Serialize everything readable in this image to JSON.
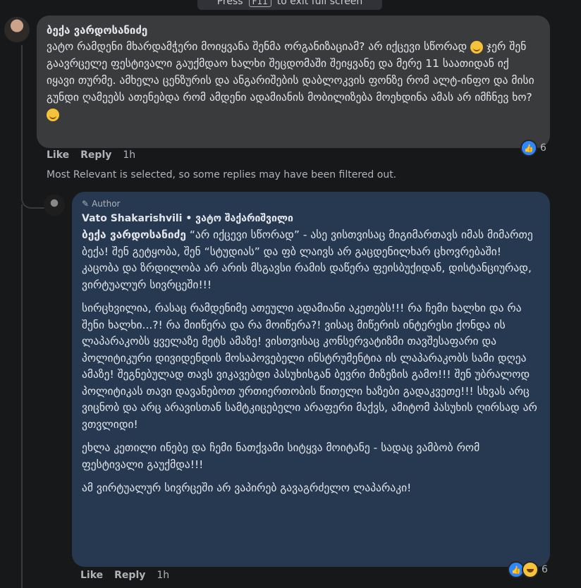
{
  "fullscreen_hint": {
    "prefix": "Press",
    "key": "F11",
    "suffix": "to exit full screen"
  },
  "comment": {
    "author": "ბექა ვარდოსანიძე",
    "text_part1": "ვატო რამდენი მხარდამჭერი მოიყვანა შენმა ორგანიზაციამ? არ იქცევი სწორად",
    "text_part2": "ჯერ შენ გაავრცელე ფესტივალი გაუქმდაო ხალხი შეცდომაში შეიყვანე და მერე 11 საათიდან იქ იყავი თურმე. ამხელა ცენზურის და ანგარიშების დაბლოკვის ფონზე რომ ალტ-ინფო და მისი გუნდი ღამეებს ათენებდა რომ ამდენი ადამიანის მობილიზება მოეხდინა ამას არ იმჩნევ ხო?",
    "like_label": "Like",
    "reply_label": "Reply",
    "time": "1h",
    "reaction_count": "6",
    "reaction_icon": "like-icon"
  },
  "filter_note": "Most Relevant is selected, so some replies may have been filtered out.",
  "reply": {
    "badge": "Author",
    "author_line": "Vato Shakarishvili • ვატო შაქარიშვილი",
    "mention": "ბექა ვარდოსანიძე",
    "p1_rest": " “არ იქცევი სწორად” - ასე ვისთვისაც მიგიმართავს იმას მიმართე ბექა! შენ გეტყობა, შენ “სტუდიას” და ფბ ლაივს არ გაცდენილხარ ცხოვრებაში! კაცობა და ზრდილობა არ არის მსგავსი რამის დაწერა ფეისბუქიდან, დისტანციურად, ვირტუალურ სივრცეში!!!",
    "p2": "სირცხვილია, რასაც რამდენიმე ათეული ადამიანი აკეთებს!!! რა ჩემი ხალხი და რა შენი ხალხი...?! რა მიიწერა და რა მოიწერა?! ვისაც მიწერის ინტერესი ქონდა ის ლაპარაკობს ყველაზე მეტს ამაზე! ვისთვისაც კონსერვატიზმი თავშესაფარი და პოლიტიკური დივიდენდის მოსაპოვებელი ინსტრუმენტია ის ლაპარაკობს სამი დღეა ამაზე! შეგნებულად თავს ვიკავებდი პასუხისგან ბევრი მიზეზის გამო!!! შენ უბრალოდ პოლიტიკას თავი დავანებოთ ურთიერთობის წითელი ხაზები გადაკვეთე!!! სხვას არც ვიცნობ და არც არავისთან სამტკიცებელი არაფერი მაქვს, ამიტომ პასუხის ღირსად არ ვთვლიდი!",
    "p3": "ეხლა კეთილი ინებე და ჩემი ნათქვამი სიტყვა მოიტანე - სადაც ვამბობ რომ ფესტივალი გაუქმდა!!!",
    "p4": "ამ ვირტუალურ სივრცეში არ ვაპირებ გავაგრძელო ლაპარაკი!",
    "like_label": "Like",
    "reply_label": "Reply",
    "time": "1h",
    "reaction_count": "6",
    "reaction_icons": [
      "like-icon",
      "haha-icon"
    ]
  },
  "colors": {
    "background": "#17181a",
    "bubble": "#3a3b3c",
    "author_bubble": "#263951",
    "like_blue": "#2d88ff"
  }
}
